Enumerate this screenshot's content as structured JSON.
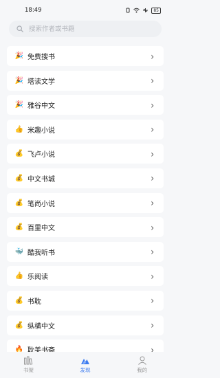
{
  "status_bar": {
    "time": "18:49",
    "battery": "85"
  },
  "search": {
    "placeholder": "搜索作者或书籍"
  },
  "sources": [
    {
      "icon": "party-popper-icon",
      "glyph": "🎉",
      "label": "免费搜书"
    },
    {
      "icon": "party-popper-icon",
      "glyph": "🎉",
      "label": "塔读文学"
    },
    {
      "icon": "party-popper-icon",
      "glyph": "🎉",
      "label": "雅谷中文"
    },
    {
      "icon": "thumbs-up-icon",
      "glyph": "👍",
      "label": "米趣小说"
    },
    {
      "icon": "money-bag-icon",
      "glyph": "💰",
      "label": "飞卢小说"
    },
    {
      "icon": "money-bag-icon",
      "glyph": "💰",
      "label": "中文书城"
    },
    {
      "icon": "money-bag-icon",
      "glyph": "💰",
      "label": "笔尚小说"
    },
    {
      "icon": "money-bag-icon",
      "glyph": "💰",
      "label": "百里中文"
    },
    {
      "icon": "whale-icon",
      "glyph": "🐳",
      "label": "酷我听书"
    },
    {
      "icon": "thumbs-up-icon",
      "glyph": "👍",
      "label": "乐阅读"
    },
    {
      "icon": "money-bag-icon",
      "glyph": "💰",
      "label": "书耽"
    },
    {
      "icon": "money-bag-icon",
      "glyph": "💰",
      "label": "纵横中文"
    },
    {
      "icon": "fire-icon",
      "glyph": "🔥",
      "label": "耽美书斋"
    }
  ],
  "tabs": [
    {
      "label": "书架",
      "icon": "bookshelf-icon"
    },
    {
      "label": "发现",
      "icon": "discover-icon",
      "active": true
    },
    {
      "label": "我的",
      "icon": "profile-icon"
    }
  ],
  "colors": {
    "accent": "#3c7bf0",
    "background": "#f6f7f9",
    "row_background": "#ffffff"
  }
}
